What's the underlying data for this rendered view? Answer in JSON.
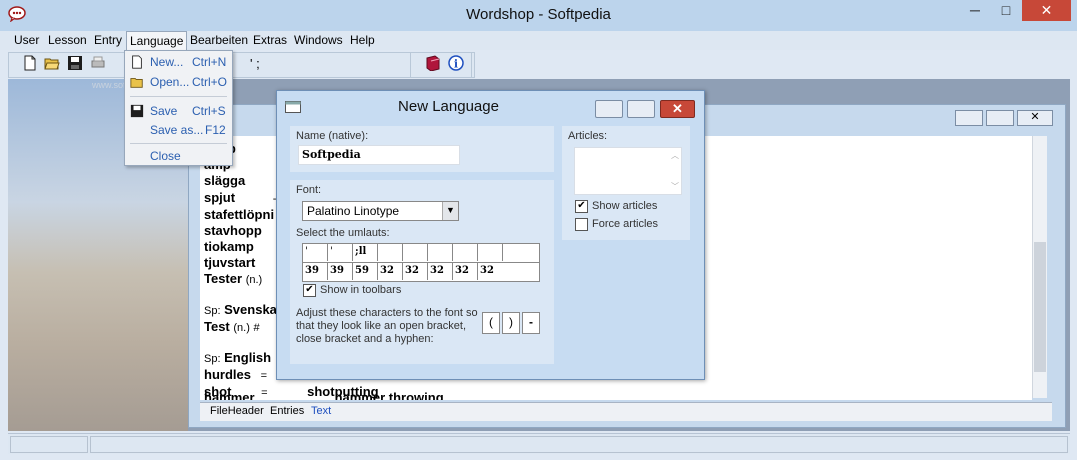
{
  "window": {
    "title": "Wordshop - Softpedia",
    "minimize": "─",
    "maximize": "□",
    "close": "✕"
  },
  "menubar": {
    "items": [
      "User",
      "Lesson",
      "Entry",
      "Language",
      "Bearbeiten",
      "Extras",
      "Windows",
      "Help"
    ]
  },
  "toolbar": {
    "extra_text": "' ;"
  },
  "language_menu": {
    "items": [
      {
        "label": "New...",
        "shortcut": "Ctrl+N"
      },
      {
        "label": "Open...",
        "shortcut": "Ctrl+O"
      },
      {
        "label": "Save",
        "shortcut": "Ctrl+S"
      },
      {
        "label": "Save as...",
        "shortcut": "F12"
      },
      {
        "label": "Close",
        "shortcut": ""
      }
    ]
  },
  "entries": {
    "lines": [
      {
        "word": "hopp",
        "tag": ""
      },
      {
        "word": "amp",
        "tag": ""
      },
      {
        "word": "slägga",
        "tag": "-"
      },
      {
        "word": "spjut",
        "tag": "-"
      },
      {
        "word": "stafettlöpni",
        "tag": ""
      },
      {
        "word": "stavhopp",
        "tag": ""
      },
      {
        "word": "tiokamp",
        "tag": ""
      },
      {
        "word": "tjuvstart",
        "tag": ""
      },
      {
        "word": "Tester",
        "tag": "(n.)"
      }
    ],
    "sp1_prefix": "Sp:",
    "sp1_word": "Svenska",
    "test_word": "Test",
    "test_tag": "(n.)",
    "test_hash": "#",
    "sp2_prefix": "Sp:",
    "sp2_word": "English",
    "hurdles": "hurdles",
    "hurdles_eq": "=",
    "shot": "shot",
    "shot_eq": "=",
    "shot_trans": "shotputting",
    "last_left": "hammer",
    "last_trans": "hammer throwing"
  },
  "tabs": [
    "FileHeader",
    "Entries",
    "Text"
  ],
  "dialog": {
    "title": "New Language",
    "name_label": "Name (native):",
    "name_value": "Softpedia",
    "font_label": "Font:",
    "font_value": "Palatino Linotype",
    "umlauts_label": "Select the umlauts:",
    "umlauts_row1": [
      "'",
      "'",
      ";ll",
      "",
      "",
      "",
      "",
      "",
      ""
    ],
    "umlauts_row2": [
      "39",
      "39",
      "59",
      "32",
      "32",
      "32",
      "32",
      "32"
    ],
    "show_toolbars": "Show in toolbars",
    "adjust_text_1": "Adjust these characters to the font so",
    "adjust_text_2": "that they look like an open bracket,",
    "adjust_text_3": "close bracket and a hyphen:",
    "bracket_open": "(",
    "bracket_close": ")",
    "hyphen": "-",
    "articles_label": "Articles:",
    "show_articles": "Show articles",
    "force_articles": "Force articles"
  },
  "watermark": "www.softpedia.com"
}
